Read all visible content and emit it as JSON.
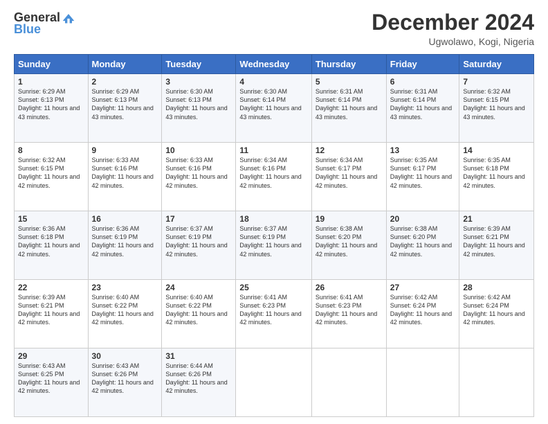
{
  "header": {
    "logo_general": "General",
    "logo_blue": "Blue",
    "title": "December 2024",
    "location": "Ugwolawo, Kogi, Nigeria"
  },
  "columns": [
    "Sunday",
    "Monday",
    "Tuesday",
    "Wednesday",
    "Thursday",
    "Friday",
    "Saturday"
  ],
  "weeks": [
    [
      {
        "day": "1",
        "sunrise": "6:29 AM",
        "sunset": "6:13 PM",
        "daylight": "11 hours and 43 minutes."
      },
      {
        "day": "2",
        "sunrise": "6:29 AM",
        "sunset": "6:13 PM",
        "daylight": "11 hours and 43 minutes."
      },
      {
        "day": "3",
        "sunrise": "6:30 AM",
        "sunset": "6:13 PM",
        "daylight": "11 hours and 43 minutes."
      },
      {
        "day": "4",
        "sunrise": "6:30 AM",
        "sunset": "6:14 PM",
        "daylight": "11 hours and 43 minutes."
      },
      {
        "day": "5",
        "sunrise": "6:31 AM",
        "sunset": "6:14 PM",
        "daylight": "11 hours and 43 minutes."
      },
      {
        "day": "6",
        "sunrise": "6:31 AM",
        "sunset": "6:14 PM",
        "daylight": "11 hours and 43 minutes."
      },
      {
        "day": "7",
        "sunrise": "6:32 AM",
        "sunset": "6:15 PM",
        "daylight": "11 hours and 43 minutes."
      }
    ],
    [
      {
        "day": "8",
        "sunrise": "6:32 AM",
        "sunset": "6:15 PM",
        "daylight": "11 hours and 42 minutes."
      },
      {
        "day": "9",
        "sunrise": "6:33 AM",
        "sunset": "6:16 PM",
        "daylight": "11 hours and 42 minutes."
      },
      {
        "day": "10",
        "sunrise": "6:33 AM",
        "sunset": "6:16 PM",
        "daylight": "11 hours and 42 minutes."
      },
      {
        "day": "11",
        "sunrise": "6:34 AM",
        "sunset": "6:16 PM",
        "daylight": "11 hours and 42 minutes."
      },
      {
        "day": "12",
        "sunrise": "6:34 AM",
        "sunset": "6:17 PM",
        "daylight": "11 hours and 42 minutes."
      },
      {
        "day": "13",
        "sunrise": "6:35 AM",
        "sunset": "6:17 PM",
        "daylight": "11 hours and 42 minutes."
      },
      {
        "day": "14",
        "sunrise": "6:35 AM",
        "sunset": "6:18 PM",
        "daylight": "11 hours and 42 minutes."
      }
    ],
    [
      {
        "day": "15",
        "sunrise": "6:36 AM",
        "sunset": "6:18 PM",
        "daylight": "11 hours and 42 minutes."
      },
      {
        "day": "16",
        "sunrise": "6:36 AM",
        "sunset": "6:19 PM",
        "daylight": "11 hours and 42 minutes."
      },
      {
        "day": "17",
        "sunrise": "6:37 AM",
        "sunset": "6:19 PM",
        "daylight": "11 hours and 42 minutes."
      },
      {
        "day": "18",
        "sunrise": "6:37 AM",
        "sunset": "6:19 PM",
        "daylight": "11 hours and 42 minutes."
      },
      {
        "day": "19",
        "sunrise": "6:38 AM",
        "sunset": "6:20 PM",
        "daylight": "11 hours and 42 minutes."
      },
      {
        "day": "20",
        "sunrise": "6:38 AM",
        "sunset": "6:20 PM",
        "daylight": "11 hours and 42 minutes."
      },
      {
        "day": "21",
        "sunrise": "6:39 AM",
        "sunset": "6:21 PM",
        "daylight": "11 hours and 42 minutes."
      }
    ],
    [
      {
        "day": "22",
        "sunrise": "6:39 AM",
        "sunset": "6:21 PM",
        "daylight": "11 hours and 42 minutes."
      },
      {
        "day": "23",
        "sunrise": "6:40 AM",
        "sunset": "6:22 PM",
        "daylight": "11 hours and 42 minutes."
      },
      {
        "day": "24",
        "sunrise": "6:40 AM",
        "sunset": "6:22 PM",
        "daylight": "11 hours and 42 minutes."
      },
      {
        "day": "25",
        "sunrise": "6:41 AM",
        "sunset": "6:23 PM",
        "daylight": "11 hours and 42 minutes."
      },
      {
        "day": "26",
        "sunrise": "6:41 AM",
        "sunset": "6:23 PM",
        "daylight": "11 hours and 42 minutes."
      },
      {
        "day": "27",
        "sunrise": "6:42 AM",
        "sunset": "6:24 PM",
        "daylight": "11 hours and 42 minutes."
      },
      {
        "day": "28",
        "sunrise": "6:42 AM",
        "sunset": "6:24 PM",
        "daylight": "11 hours and 42 minutes."
      }
    ],
    [
      {
        "day": "29",
        "sunrise": "6:43 AM",
        "sunset": "6:25 PM",
        "daylight": "11 hours and 42 minutes."
      },
      {
        "day": "30",
        "sunrise": "6:43 AM",
        "sunset": "6:26 PM",
        "daylight": "11 hours and 42 minutes."
      },
      {
        "day": "31",
        "sunrise": "6:44 AM",
        "sunset": "6:26 PM",
        "daylight": "11 hours and 42 minutes."
      },
      null,
      null,
      null,
      null
    ]
  ]
}
